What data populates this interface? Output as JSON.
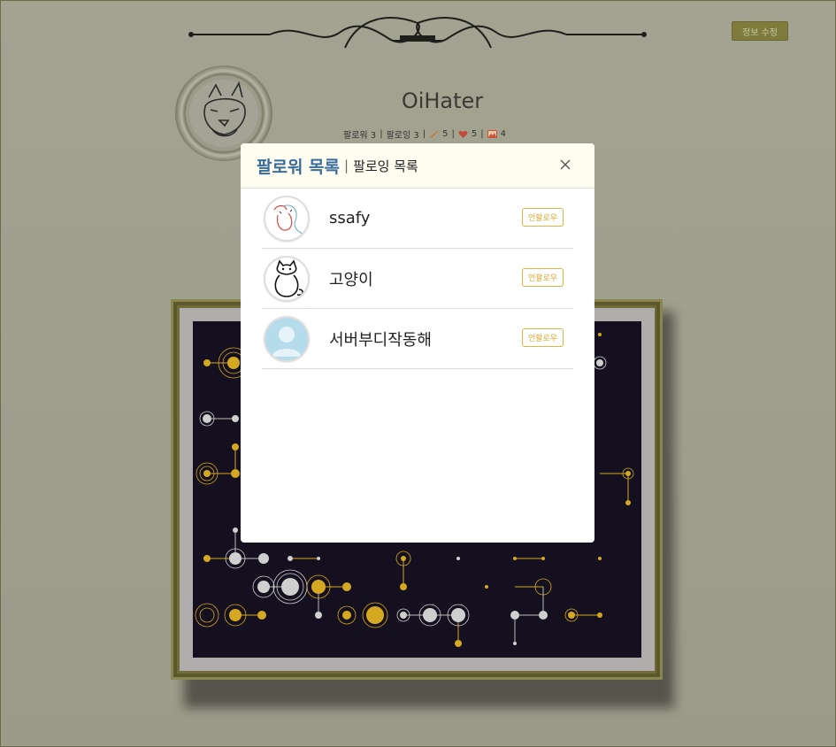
{
  "profile": {
    "username": "OiHater",
    "edit_label": "정보 수정",
    "followers_label": "팔로워 3",
    "following_label": "팔로잉 3",
    "paintings_count": "5",
    "likes_count": "5",
    "gallery_count": "4",
    "separator": "|"
  },
  "modal": {
    "tab_followers": "팔로워 목록",
    "tab_separator": "|",
    "tab_following": "팔로잉 목록",
    "users": [
      {
        "name": "ssafy",
        "action": "언팔로우"
      },
      {
        "name": "고양이",
        "action": "언팔로우"
      },
      {
        "name": "서버부디작동해",
        "action": "언팔로우"
      }
    ]
  },
  "colors": {
    "accent_blue": "#3c6c9c",
    "unfollow_gold": "#e3b341",
    "frame_olive": "#6f6c38",
    "canvas_dark": "#15101f"
  }
}
